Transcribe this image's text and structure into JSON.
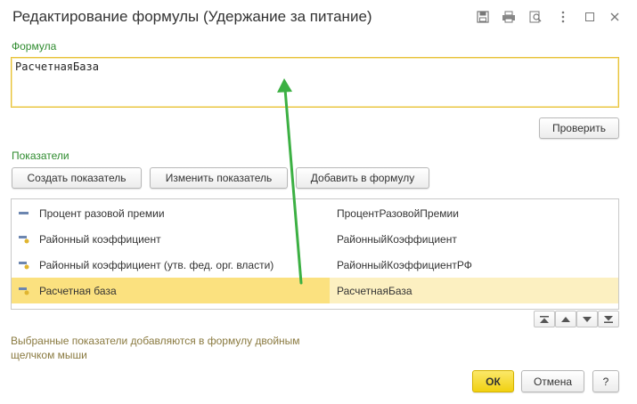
{
  "window": {
    "title": "Редактирование формулы (Удержание за питание)"
  },
  "formula": {
    "label": "Формула",
    "value": "РасчетнаяБаза"
  },
  "check_button": "Проверить",
  "indicators": {
    "label": "Показатели",
    "create_button": "Создать показатель",
    "edit_button": "Изменить показатель",
    "add_button": "Добавить в формулу",
    "rows": [
      {
        "name": "Процент разовой премии",
        "id": "ПроцентРазовойПремии",
        "icon": "dash-icon",
        "selected": false
      },
      {
        "name": "Районный коэффициент",
        "id": "РайонныйКоэффициент",
        "icon": "dash-dot-icon",
        "selected": false
      },
      {
        "name": "Районный коэффициент (утв. фед. орг. власти)",
        "id": "РайонныйКоэффициентРФ",
        "icon": "dash-dot-icon",
        "selected": false
      },
      {
        "name": "Расчетная база",
        "id": "РасчетнаяБаза",
        "icon": "dash-dot-icon",
        "selected": true
      }
    ]
  },
  "hint": "Выбранные показатели добавляются в формулу двойным щелчком мыши",
  "footer": {
    "ok": "ОК",
    "cancel": "Отмена",
    "help": "?"
  },
  "colors": {
    "accent_green": "#2e8b2e",
    "selected_row": "#fbe17f",
    "arrow": "#3cb043"
  }
}
